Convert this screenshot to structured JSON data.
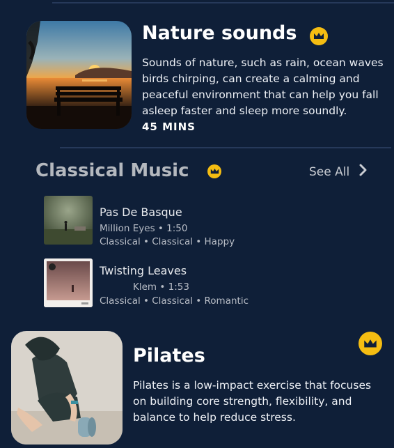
{
  "colors": {
    "background": "#0f1f38",
    "accent_gold": "#f5bd12",
    "divider": "#26395a"
  },
  "nature": {
    "title": "Nature sounds",
    "description": "Sounds of nature, such as rain, ocean waves birds chirping, can create a calming and peaceful environment that can help you fall asleep faster and sleep more soundly.",
    "duration": "45 MINS",
    "badge_icon": "crown-icon"
  },
  "classical": {
    "title": "Classical Music",
    "see_all": "See All",
    "badge_icon": "crown-icon",
    "tracks": [
      {
        "title": "Pas De Basque",
        "artist_line": "Million Eyes • 1:50",
        "tags": "Classical • Classical • Happy"
      },
      {
        "title": "Twisting Leaves",
        "artist_line": "Klem • 1:53",
        "tags": "Classical • Classical • Romantic"
      }
    ]
  },
  "pilates": {
    "title": "Pilates",
    "description": "Pilates is a low-impact exercise that focuses on building core strength, flexibility, and balance to help reduce stress.",
    "badge_icon": "crown-icon"
  }
}
